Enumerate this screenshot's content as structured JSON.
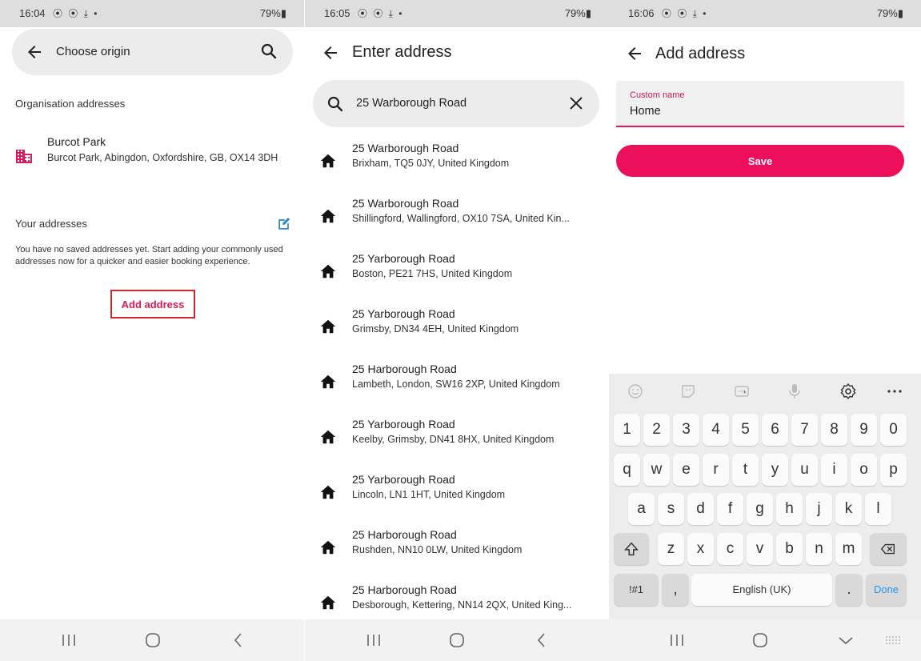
{
  "screens": {
    "choose_origin": {
      "status": {
        "time": "16:04",
        "icons": "⦿ ⦿ ⤓ •",
        "battery": "79%▮"
      },
      "title": "Choose origin",
      "org_section_label": "Organisation addresses",
      "org_item": {
        "name": "Burcot Park",
        "address": "Burcot Park, Abingdon, Oxfordshire, GB, OX14 3DH"
      },
      "your_addresses_label": "Your addresses",
      "empty_message": "You have no saved addresses yet. Start adding your commonly used addresses now for a quicker and easier booking experience.",
      "add_address_label": "Add address"
    },
    "enter_address": {
      "status": {
        "time": "16:05",
        "icons": "⦿ ⦿ ⤓ •",
        "battery": "79%▮"
      },
      "title": "Enter address",
      "search_value": "25 Warborough Road",
      "results": [
        {
          "title": "25 Warborough Road",
          "subtitle": "Brixham, TQ5 0JY, United Kingdom"
        },
        {
          "title": "25 Warborough Road",
          "subtitle": "Shillingford, Wallingford, OX10 7SA, United Kin..."
        },
        {
          "title": "25 Yarborough Road",
          "subtitle": "Boston, PE21 7HS, United Kingdom"
        },
        {
          "title": "25 Yarborough Road",
          "subtitle": "Grimsby, DN34 4EH, United Kingdom"
        },
        {
          "title": "25 Harborough Road",
          "subtitle": "Lambeth, London, SW16 2XP, United Kingdom"
        },
        {
          "title": "25 Yarborough Road",
          "subtitle": "Keelby, Grimsby, DN41 8HX, United Kingdom"
        },
        {
          "title": "25 Yarborough Road",
          "subtitle": "Lincoln, LN1 1HT, United Kingdom"
        },
        {
          "title": "25 Harborough Road",
          "subtitle": "Rushden, NN10 0LW, United Kingdom"
        },
        {
          "title": "25 Harborough Road",
          "subtitle": "Desborough, Kettering, NN14 2QX, United King..."
        }
      ]
    },
    "add_address": {
      "status": {
        "time": "16:06",
        "icons": "⦿ ⦿ ⤓ •",
        "battery": "79%▮"
      },
      "title": "Add address",
      "field_label": "Custom name",
      "field_value": "Home",
      "save_label": "Save",
      "keyboard": {
        "row_numbers": [
          "1",
          "2",
          "3",
          "4",
          "5",
          "6",
          "7",
          "8",
          "9",
          "0"
        ],
        "row_1": [
          "q",
          "w",
          "e",
          "r",
          "t",
          "y",
          "u",
          "i",
          "o",
          "p"
        ],
        "row_2": [
          "a",
          "s",
          "d",
          "f",
          "g",
          "h",
          "j",
          "k",
          "l"
        ],
        "row_3": [
          "z",
          "x",
          "c",
          "v",
          "b",
          "n",
          "m"
        ],
        "symbols_label": "!#1",
        "comma_label": ",",
        "space_label": "English (UK)",
        "period_label": ".",
        "done_label": "Done"
      }
    }
  },
  "colors": {
    "accent": "#ec0f5c",
    "accent_text": "#d8195c",
    "highlight_box": "#d62828",
    "org_icon": "#d81b60"
  }
}
